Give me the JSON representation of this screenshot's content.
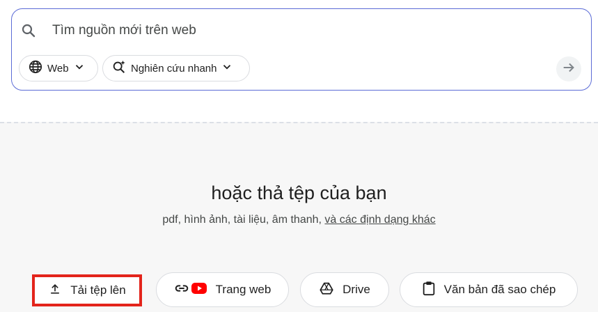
{
  "search": {
    "placeholder": "Tìm nguồn mới trên web",
    "value": ""
  },
  "chips": {
    "source_label": "Web",
    "mode_label": "Nghiên cứu nhanh"
  },
  "drop_zone": {
    "title": "hoặc thả tệp của bạn",
    "subtitle": "pdf, hình ảnh, tài liệu, âm thanh,",
    "formats_link": "và các định dạng khác"
  },
  "source_buttons": {
    "upload": "Tải tệp lên",
    "website": "Trang web",
    "drive": "Drive",
    "copied_text": "Văn bản đã sao chép"
  },
  "colors": {
    "focus_border": "#5b6bd6",
    "highlight": "#e3241b",
    "youtube_red": "#ff0000"
  }
}
